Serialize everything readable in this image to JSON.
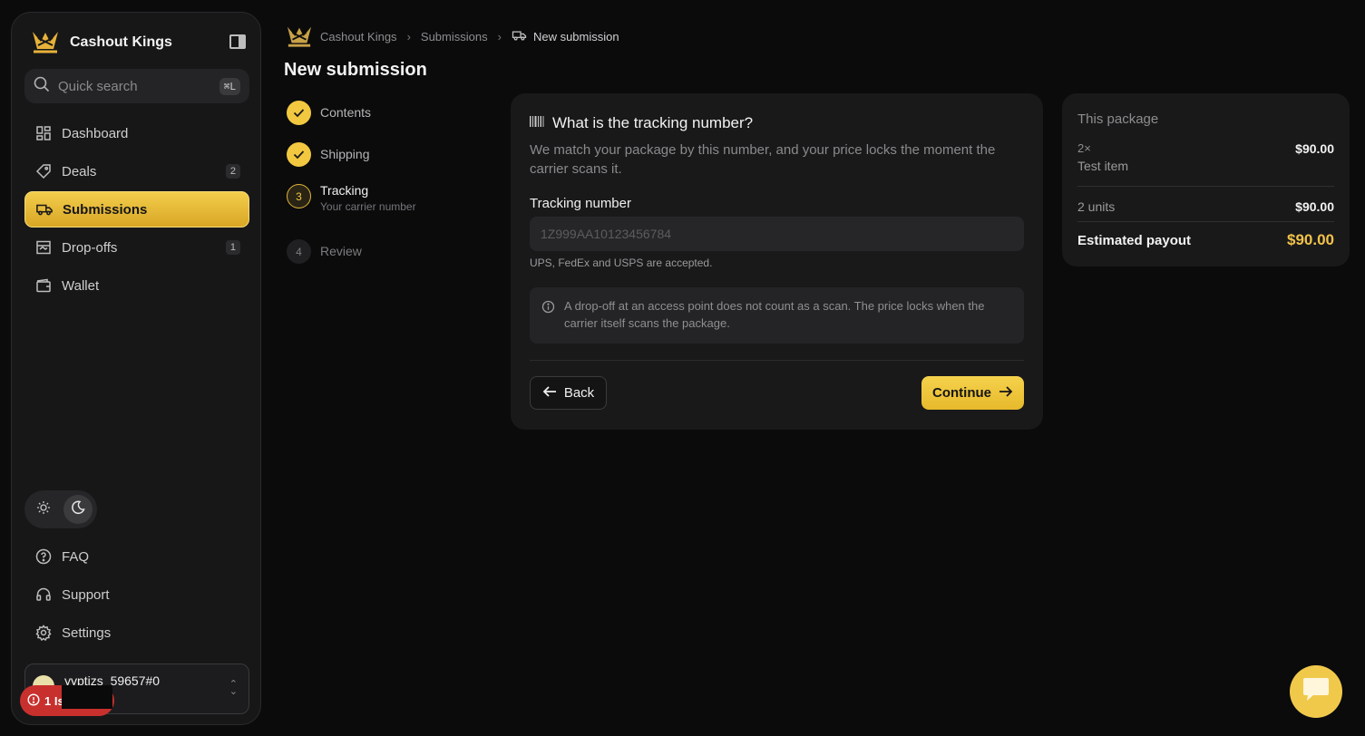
{
  "brand": {
    "name": "Cashout Kings"
  },
  "search": {
    "placeholder": "Quick search",
    "shortcut": "⌘L"
  },
  "nav": [
    {
      "label": "Dashboard",
      "icon": "dashboard-icon"
    },
    {
      "label": "Deals",
      "icon": "tag-icon",
      "badge": "2"
    },
    {
      "label": "Submissions",
      "icon": "truck-icon",
      "active": true
    },
    {
      "label": "Drop-offs",
      "icon": "store-icon",
      "badge": "1"
    },
    {
      "label": "Wallet",
      "icon": "wallet-icon"
    }
  ],
  "bottom_nav": [
    {
      "label": "FAQ",
      "icon": "help-icon"
    },
    {
      "label": "Support",
      "icon": "headset-icon"
    },
    {
      "label": "Settings",
      "icon": "gear-icon"
    }
  ],
  "user": {
    "name": "yyptizs_59657#0"
  },
  "issue": {
    "label": "1 Is"
  },
  "breadcrumb": {
    "root": "Cashout Kings",
    "section": "Submissions",
    "current": "New submission"
  },
  "page_title": "New submission",
  "steps": [
    {
      "label": "Contents",
      "state": "done"
    },
    {
      "label": "Shipping",
      "state": "done"
    },
    {
      "number": "3",
      "label": "Tracking",
      "sub": "Your carrier number",
      "state": "current"
    },
    {
      "number": "4",
      "label": "Review",
      "state": "todo"
    }
  ],
  "form": {
    "heading": "What is the tracking number?",
    "description": "We match your package by this number, and your price locks the moment the carrier scans it.",
    "field_label": "Tracking number",
    "placeholder": "1Z999AA10123456784",
    "hint": "UPS, FedEx and USPS are accepted.",
    "note": "A drop-off at an access point does not count as a scan. The price locks when the carrier itself scans the package.",
    "back_label": "Back",
    "continue_label": "Continue"
  },
  "summary": {
    "title": "This package",
    "qty": "2×",
    "item": "Test item",
    "item_price": "$90.00",
    "units": "2 units",
    "units_price": "$90.00",
    "payout_label": "Estimated payout",
    "payout": "$90.00"
  },
  "colors": {
    "accent": "#f1c840",
    "payout": "#f2c24a",
    "issue": "#c8302e"
  }
}
